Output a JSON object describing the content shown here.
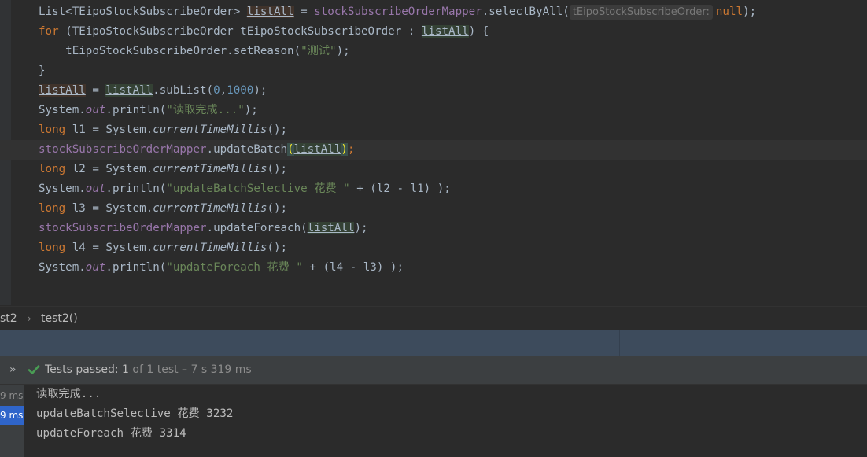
{
  "editor": {
    "lines": [
      {
        "parts": [
          {
            "t": "List<TEipoStockSubscribeOrder> ",
            "c": "plain"
          },
          {
            "t": "listAll",
            "c": "loc2"
          },
          {
            "t": " = ",
            "c": "plain"
          },
          {
            "t": "stockSubscribeOrderMapper",
            "c": "fld"
          },
          {
            "t": ".selectByAll(",
            "c": "plain"
          },
          {
            "t": "tEipoStockSubscribeOrder:",
            "c": "hint"
          },
          {
            "t": "null",
            "c": "kw"
          },
          {
            "t": ");",
            "c": "plain"
          }
        ]
      },
      {
        "parts": [
          {
            "t": "for ",
            "c": "kw"
          },
          {
            "t": "(TEipoStockSubscribeOrder tEipoStockSubscribeOrder : ",
            "c": "plain"
          },
          {
            "t": "listAll",
            "c": "loc"
          },
          {
            "t": ") {",
            "c": "plain"
          }
        ]
      },
      {
        "parts": [
          {
            "t": "    tEipoStockSubscribeOrder.setReason(",
            "c": "plain"
          },
          {
            "t": "\"测试\"",
            "c": "str"
          },
          {
            "t": ");",
            "c": "plain"
          }
        ]
      },
      {
        "parts": [
          {
            "t": "}",
            "c": "plain"
          }
        ]
      },
      {
        "parts": [
          {
            "t": "listAll",
            "c": "loc2"
          },
          {
            "t": " = ",
            "c": "plain"
          },
          {
            "t": "listAll",
            "c": "loc"
          },
          {
            "t": ".subList(",
            "c": "plain"
          },
          {
            "t": "0",
            "c": "num"
          },
          {
            "t": ",",
            "c": "plain"
          },
          {
            "t": "1000",
            "c": "num"
          },
          {
            "t": ");",
            "c": "plain"
          }
        ]
      },
      {
        "parts": [
          {
            "t": "System.",
            "c": "plain"
          },
          {
            "t": "out",
            "c": "st"
          },
          {
            "t": ".println(",
            "c": "plain"
          },
          {
            "t": "\"读取完成...\"",
            "c": "str"
          },
          {
            "t": ");",
            "c": "plain"
          }
        ]
      },
      {
        "parts": [
          {
            "t": "long ",
            "c": "kw"
          },
          {
            "t": "l1 = System.",
            "c": "plain"
          },
          {
            "t": "currentTimeMillis",
            "c": "stm"
          },
          {
            "t": "();",
            "c": "plain"
          }
        ]
      },
      {
        "current": true,
        "parts": [
          {
            "t": "stockSubscribeOrderMapper",
            "c": "fld"
          },
          {
            "t": ".updateBatch",
            "c": "plain"
          },
          {
            "t": "(",
            "c": "brace"
          },
          {
            "t": "listAll",
            "c": "loc"
          },
          {
            "t": ")",
            "c": "brace"
          },
          {
            "t": ";",
            "c": "kw"
          }
        ]
      },
      {
        "parts": [
          {
            "t": "long ",
            "c": "kw"
          },
          {
            "t": "l2 = System.",
            "c": "plain"
          },
          {
            "t": "currentTimeMillis",
            "c": "stm"
          },
          {
            "t": "();",
            "c": "plain"
          }
        ]
      },
      {
        "parts": [
          {
            "t": "System.",
            "c": "plain"
          },
          {
            "t": "out",
            "c": "st"
          },
          {
            "t": ".println(",
            "c": "plain"
          },
          {
            "t": "\"updateBatchSelective 花费 \"",
            "c": "str"
          },
          {
            "t": " + (l2 - l1) );",
            "c": "plain"
          }
        ]
      },
      {
        "parts": [
          {
            "t": "long ",
            "c": "kw"
          },
          {
            "t": "l3 = System.",
            "c": "plain"
          },
          {
            "t": "currentTimeMillis",
            "c": "stm"
          },
          {
            "t": "();",
            "c": "plain"
          }
        ]
      },
      {
        "parts": [
          {
            "t": "stockSubscribeOrderMapper",
            "c": "fld"
          },
          {
            "t": ".updateForeach(",
            "c": "plain"
          },
          {
            "t": "listAll",
            "c": "loc"
          },
          {
            "t": ");",
            "c": "plain"
          }
        ]
      },
      {
        "parts": [
          {
            "t": "long ",
            "c": "kw"
          },
          {
            "t": "l4 = System.",
            "c": "plain"
          },
          {
            "t": "currentTimeMillis",
            "c": "stm"
          },
          {
            "t": "();",
            "c": "plain"
          }
        ]
      },
      {
        "parts": [
          {
            "t": "System.",
            "c": "plain"
          },
          {
            "t": "out",
            "c": "st"
          },
          {
            "t": ".println(",
            "c": "plain"
          },
          {
            "t": "\"updateForeach 花费 \"",
            "c": "str"
          },
          {
            "t": " + (l4 - l3) );",
            "c": "plain"
          }
        ]
      }
    ]
  },
  "breadcrumb": {
    "class_name": "st2",
    "separator": "›",
    "method_name": "test2()"
  },
  "run_status": {
    "expand_icon": "»",
    "label": "Tests passed: ",
    "count": "1",
    "detail": " of 1 test – 7 s 319 ms"
  },
  "test_tree": {
    "rows": [
      {
        "time": "9 ms",
        "selected": false
      },
      {
        "time": "9 ms",
        "selected": true
      }
    ]
  },
  "console": {
    "lines": [
      "读取完成...",
      "updateBatchSelective 花费 3232",
      "updateForeach 花费 3314"
    ]
  },
  "colors": {
    "editor_bg": "#2b2b2b",
    "keyword": "#cc7832",
    "string": "#6a8759",
    "field": "#9876aa",
    "number": "#6897bb",
    "toolbar": "#3d4b5c",
    "passed_check": "#499c54",
    "selection": "#2f65ca"
  }
}
